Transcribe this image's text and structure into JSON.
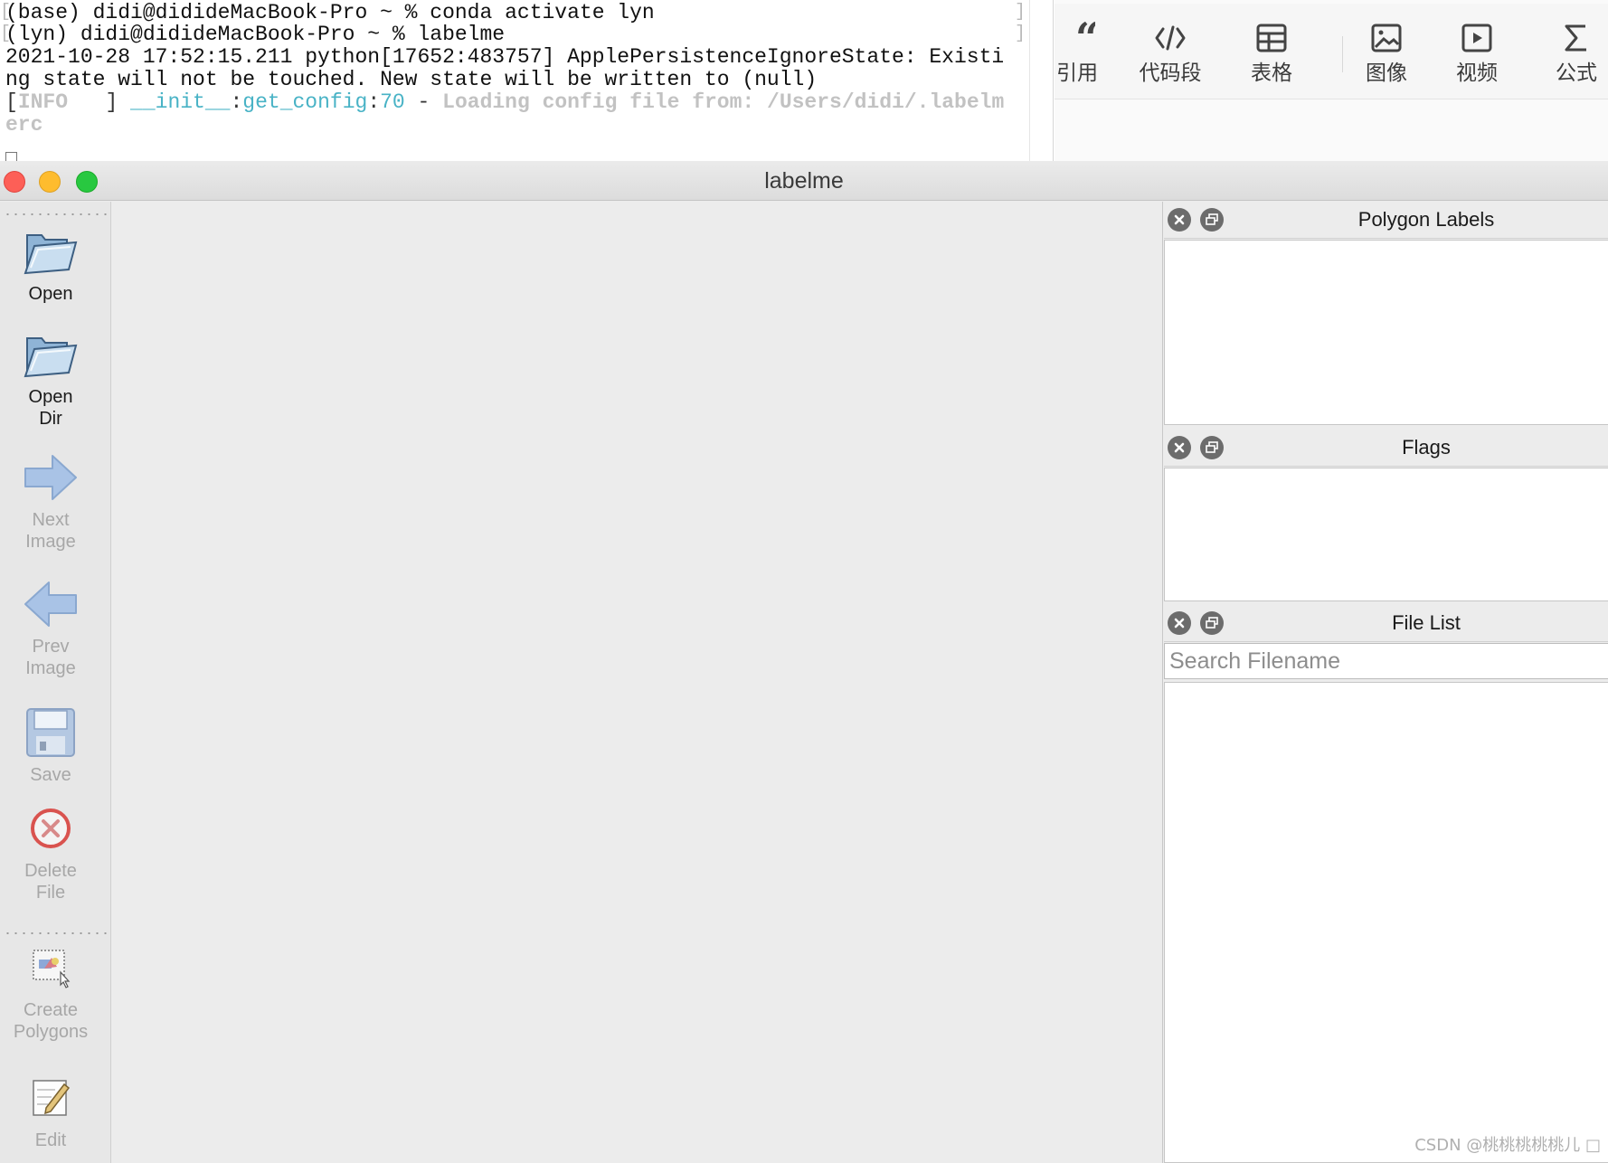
{
  "terminal": {
    "line1": "(base) didi@didideMacBook-Pro ~ % conda activate lyn",
    "line2": "(lyn) didi@didideMacBook-Pro ~ % labelme",
    "line3": "2021-10-28 17:52:15.211 python[17652:483757] ApplePersistenceIgnoreState: Existi",
    "line4": "ng state will not be touched. New state will be written to (null)",
    "line5": {
      "open": "[",
      "level": "INFO",
      "close": "   ] ",
      "module": "__init__",
      "sep1": ":",
      "func": "get_config",
      "sep2": ":",
      "lineno": "70",
      "dash": " - ",
      "message": "Loading config file from: /Users/didi/.labelm"
    },
    "line6": "erc"
  },
  "editor_toolbar": {
    "items": [
      {
        "label": "引用",
        "icon": "quote-icon"
      },
      {
        "label": "代码段",
        "icon": "code-icon"
      },
      {
        "label": "表格",
        "icon": "table-icon"
      },
      {
        "label": "图像",
        "icon": "image-icon"
      },
      {
        "label": "视频",
        "icon": "video-icon"
      },
      {
        "label": "公式",
        "icon": "sigma-icon"
      }
    ]
  },
  "window": {
    "title": "labelme"
  },
  "left_toolbar": {
    "open": "Open",
    "open_dir": "Open\nDir",
    "next_image": "Next\nImage",
    "prev_image": "Prev\nImage",
    "save": "Save",
    "delete_file": "Delete\nFile",
    "create_polygons": "Create\nPolygons",
    "edit": "Edit"
  },
  "docks": {
    "polygon_labels": "Polygon Labels",
    "flags": "Flags",
    "file_list": "File List",
    "search_placeholder": "Search Filename"
  },
  "watermark": "CSDN @桃桃桃桃桃儿 □",
  "colors": {
    "traffic_close": "#fd5f57",
    "traffic_min": "#febc2e",
    "traffic_max": "#28c840",
    "terminal_cyan": "#49b3c6"
  }
}
